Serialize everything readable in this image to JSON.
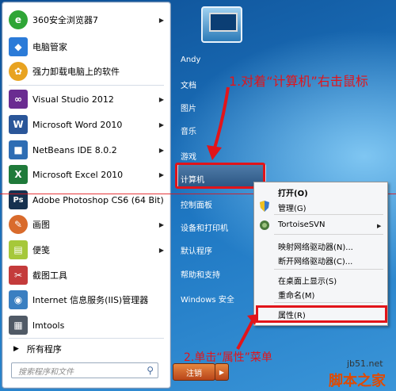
{
  "programs": [
    {
      "label": "360安全浏览器7",
      "icon": "browser-360-icon",
      "color": "#2fa536",
      "submenu": true
    },
    {
      "label": "电脑管家",
      "icon": "shield-icon",
      "color": "#2b7bd8",
      "submenu": false
    },
    {
      "label": "强力卸载电脑上的软件",
      "icon": "uninstall-icon",
      "color": "#e8a321",
      "submenu": false
    },
    {
      "label": "Visual Studio 2012",
      "icon": "visual-studio-icon",
      "color": "#6a2c91",
      "submenu": true
    },
    {
      "label": "Microsoft Word 2010",
      "icon": "word-icon",
      "color": "#2a5699",
      "submenu": true
    },
    {
      "label": "NetBeans IDE 8.0.2",
      "icon": "netbeans-icon",
      "color": "#2e6db4",
      "submenu": true
    },
    {
      "label": "Microsoft Excel 2010",
      "icon": "excel-icon",
      "color": "#1f7a3a",
      "submenu": true
    },
    {
      "label": "Adobe Photoshop CS6 (64 Bit)",
      "icon": "photoshop-icon",
      "color": "#16314f",
      "submenu": false
    },
    {
      "label": "画图",
      "icon": "paint-icon",
      "color": "#d96b2c",
      "submenu": true
    },
    {
      "label": "便笺",
      "icon": "sticky-notes-icon",
      "color": "#a6c83a",
      "submenu": true
    },
    {
      "label": "截图工具",
      "icon": "snipping-tool-icon",
      "color": "#c43b3b",
      "submenu": false
    },
    {
      "label": "Internet 信息服务(IIS)管理器",
      "icon": "iis-icon",
      "color": "#3a7fc1",
      "submenu": false
    },
    {
      "label": "lmtools",
      "icon": "lmtools-icon",
      "color": "#505a66",
      "submenu": false
    }
  ],
  "all_programs": "所有程序",
  "search_placeholder": "搜索程序和文件",
  "right_pane": {
    "user": "Andy",
    "items": [
      "文档",
      "图片",
      "音乐",
      "游戏",
      "计算机",
      "控制面板",
      "设备和打印机",
      "默认程序",
      "帮助和支持",
      "Windows 安全"
    ],
    "shutdown": "注销"
  },
  "context_menu": {
    "items": [
      "打开(O)",
      "管理(G)",
      "TortoiseSVN",
      "映射网络驱动器(N)...",
      "断开网络驱动器(C)...",
      "在桌面上显示(S)",
      "重命名(M)",
      "属性(R)"
    ]
  },
  "annotations": {
    "step1": "1.对着“计算机”右击鼠标",
    "step2": "2.单击“属性”菜单"
  },
  "watermark": {
    "url": "jb51.net",
    "name": "脚本之家"
  },
  "colors": {
    "annotation_red": "#e2141a",
    "start_menu_bg": "#ffffff",
    "watermark_orange": "#e04a00"
  }
}
